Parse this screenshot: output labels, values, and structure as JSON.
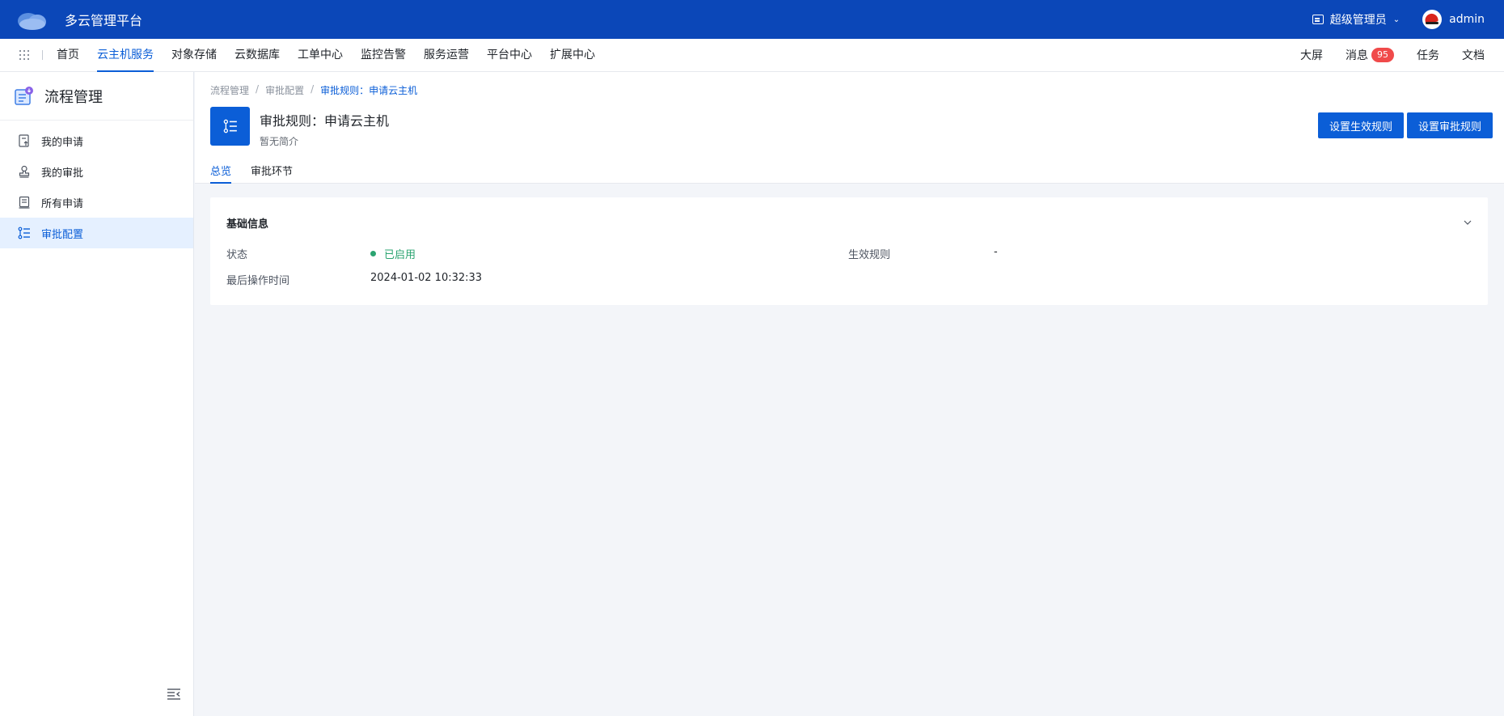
{
  "app": {
    "title": "多云管理平台"
  },
  "topbar": {
    "role": "超级管理员",
    "username": "admin"
  },
  "nav": {
    "items": [
      {
        "label": "首页"
      },
      {
        "label": "云主机服务",
        "active": true
      },
      {
        "label": "对象存储"
      },
      {
        "label": "云数据库"
      },
      {
        "label": "工单中心"
      },
      {
        "label": "监控告警"
      },
      {
        "label": "服务运营"
      },
      {
        "label": "平台中心"
      },
      {
        "label": "扩展中心"
      }
    ],
    "right": {
      "screen": "大屏",
      "messages": "消息",
      "message_count": "95",
      "tasks": "任务",
      "docs": "文档"
    }
  },
  "sidebar": {
    "title": "流程管理",
    "items": [
      {
        "label": "我的申请",
        "icon": "my-request-icon"
      },
      {
        "label": "我的审批",
        "icon": "stamp-icon"
      },
      {
        "label": "所有申请",
        "icon": "all-requests-icon"
      },
      {
        "label": "审批配置",
        "icon": "list-config-icon",
        "active": true
      }
    ]
  },
  "breadcrumb": [
    "流程管理",
    "审批配置",
    "审批规则：申请云主机"
  ],
  "page": {
    "title": "审批规则：申请云主机",
    "description": "暂无简介",
    "actions": {
      "set_effective": "设置生效规则",
      "set_approval": "设置审批规则"
    },
    "tabs": [
      {
        "label": "总览",
        "active": true
      },
      {
        "label": "审批环节"
      }
    ]
  },
  "card": {
    "title": "基础信息",
    "fields": {
      "status_label": "状态",
      "status_value": "已启用",
      "effective_label": "生效规则",
      "effective_value": "-",
      "last_op_label": "最后操作时间",
      "last_op_value": "2024-01-02 10:32:33"
    }
  },
  "colors": {
    "brand": "#0b47b8",
    "primary": "#0b5ed7",
    "success": "#2ba471",
    "badge": "#f04a4a"
  }
}
